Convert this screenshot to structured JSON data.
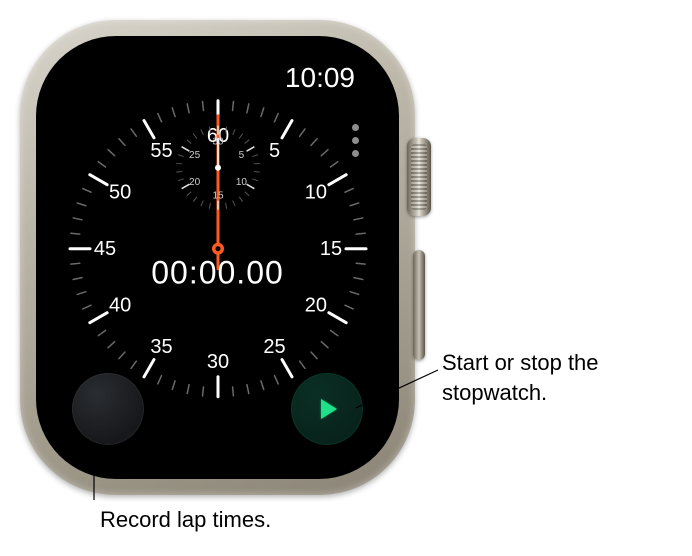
{
  "status": {
    "time": "10:09"
  },
  "dial": {
    "major_numbers": [
      "60",
      "5",
      "10",
      "15",
      "20",
      "25",
      "30",
      "35",
      "40",
      "45",
      "50",
      "55"
    ],
    "sub_numbers": [
      "30",
      "5",
      "10",
      "15",
      "20",
      "25"
    ],
    "elapsed": "00:00.00"
  },
  "buttons": {
    "lap_name": "lap-button",
    "start_name": "start-stop-button"
  },
  "callouts": {
    "start_stop": "Start or stop the stopwatch.",
    "lap": "Record lap times."
  }
}
